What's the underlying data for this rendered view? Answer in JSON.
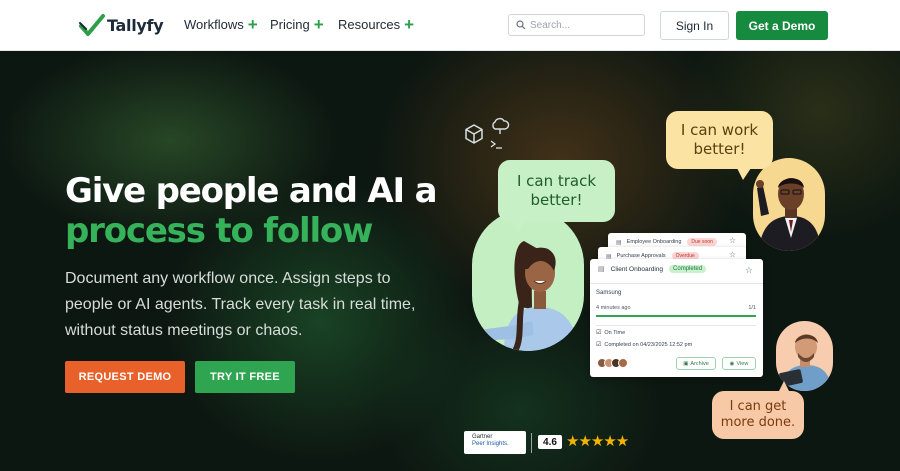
{
  "nav": {
    "logo_text": "Tallyfy",
    "menu": [
      {
        "label": "Workflows"
      },
      {
        "label": "Pricing"
      },
      {
        "label": "Resources"
      }
    ],
    "search_placeholder": "Search...",
    "signin_label": "Sign In",
    "get_demo_label": "Get a Demo"
  },
  "hero": {
    "headline_line1": "Give people and AI a",
    "headline_line2": "process to follow",
    "subtext": "Document any workflow once. Assign steps to people or AI agents. Track every task in real time, without status meetings or chaos.",
    "request_demo_label": "REQUEST DEMO",
    "try_free_label": "TRY IT FREE"
  },
  "bubbles": {
    "track": "I can track better!",
    "work": "I can work better!",
    "done": "I can get more done."
  },
  "cards": {
    "back1": {
      "title": "Employee Onboarding",
      "tag": "Due soon"
    },
    "back2": {
      "title": "Purchase Approvals",
      "tag": "Overdue"
    },
    "main": {
      "title": "Client Onboarding",
      "tag": "Completed",
      "company": "Samsung",
      "time_ago": "4 minutes ago",
      "progress_label": "1/1",
      "progress": 1.0,
      "status": "On Time",
      "completed_text": "Completed on 04/23/2025 12:52 pm",
      "archive_label": "Archive",
      "view_label": "View"
    }
  },
  "rating": {
    "badge_line1": "Gartner",
    "badge_line2": "Peer Insights.",
    "score": "4.6",
    "stars": "★★★★★"
  },
  "colors": {
    "brand_green": "#168a3f",
    "accent_orange": "#e8612a",
    "headline_green": "#36b25a"
  }
}
